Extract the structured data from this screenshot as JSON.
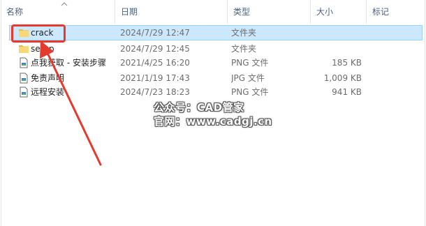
{
  "columns": {
    "name": "名称",
    "date": "日期",
    "type": "类型",
    "size": "大小",
    "tags": "标记"
  },
  "files": [
    {
      "name": "crack",
      "date": "2024/7/29 12:47",
      "type": "文件夹",
      "size": "",
      "icon": "folder-icon",
      "selected": true
    },
    {
      "name": "setup",
      "date": "2024/7/29 12:45",
      "type": "文件夹",
      "size": "",
      "icon": "folder-icon",
      "selected": false
    },
    {
      "name": "点我获取 - 安装步骤",
      "date": "2021/4/25 16:20",
      "type": "PNG 文件",
      "size": "185 KB",
      "icon": "image-file-icon",
      "selected": false
    },
    {
      "name": "免责声明",
      "date": "2021/1/19 17:43",
      "type": "JPG 文件",
      "size": "1,009 KB",
      "icon": "image-file-icon",
      "selected": false
    },
    {
      "name": "远程安装",
      "date": "2024/7/23 18:23",
      "type": "PNG 文件",
      "size": "941 KB",
      "icon": "image-file-icon",
      "selected": false
    }
  ],
  "watermark": {
    "line1": "公众号：CAD管家",
    "line2": "官网：www.cadgj.cn"
  },
  "colors": {
    "selection": "#cce8ff",
    "annotation_red": "#e53a2e",
    "folder": "#f8d775"
  }
}
